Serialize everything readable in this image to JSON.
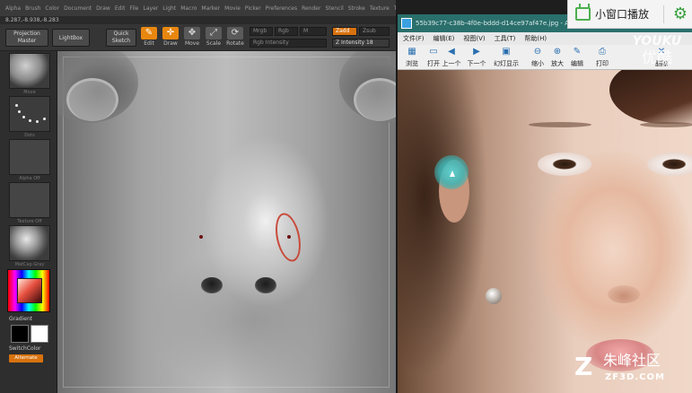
{
  "zbrush": {
    "menu": [
      "Alpha",
      "Brush",
      "Color",
      "Document",
      "Draw",
      "Edit",
      "File",
      "Layer",
      "Light",
      "Macro",
      "Marker",
      "Movie",
      "Picker",
      "Preferences",
      "Render",
      "Stencil",
      "Stroke",
      "Texture",
      "Tool",
      "Transform",
      "Zplugin",
      "Zscript"
    ],
    "coords": "8.287,-8.938,-8.283",
    "toolbar": {
      "projection_master": "Projection Master",
      "lightbox": "LightBox",
      "quick_sketch": "Quick Sketch",
      "edit": "Edit",
      "draw": "Draw",
      "move": "Move",
      "scale": "Scale",
      "rotate": "Rotate",
      "mrgb": "Mrgb",
      "rgb": "Rgb",
      "m": "M",
      "zadd": "Zadd",
      "zsub": "Zsub",
      "z_intensity": "Z Intensity 18",
      "rgb_intensity": "Rgb Intensity"
    },
    "shelf": {
      "brush_label": "Move",
      "stroke_label": "Dots",
      "alpha_label": "Alpha Off",
      "texture_label": "Texture Off",
      "material_label": "MatCap Gray",
      "gradient_label": "Gradient",
      "switchcolor_label": "SwitchColor",
      "alternate_label": "Alternate"
    }
  },
  "viewer": {
    "title": "55b39c77-c38b-4f0e-bddd-d14ce97af47e.jpg - ACDSee 9",
    "menu": [
      "文件(F)",
      "编辑(E)",
      "视图(V)",
      "工具(T)",
      "帮助(H)"
    ],
    "tools": [
      {
        "label": "浏览",
        "icon": "browse-icon",
        "glyph": "▦"
      },
      {
        "label": "打开",
        "icon": "open-folder-icon",
        "glyph": "▭"
      },
      {
        "label": "上一个",
        "icon": "previous-icon",
        "glyph": "◀"
      },
      {
        "label": "下一个",
        "icon": "next-icon",
        "glyph": "▶"
      },
      {
        "label": "幻灯显示",
        "icon": "slideshow-icon",
        "glyph": "▣"
      },
      {
        "label": "缩小",
        "icon": "zoom-out-icon",
        "glyph": "⊖"
      },
      {
        "label": "放大",
        "icon": "zoom-in-icon",
        "glyph": "⊕"
      },
      {
        "label": "编辑",
        "icon": "edit-icon",
        "glyph": "✎"
      },
      {
        "label": "打印",
        "icon": "print-icon",
        "glyph": "⎙"
      },
      {
        "label": "删除",
        "icon": "delete-icon",
        "glyph": "✕"
      }
    ]
  },
  "overlay": {
    "mini_window": "小窗口播放",
    "youku_en": "YOUKU",
    "youku_cn": "优酷",
    "zf_cn": "朱峰社区",
    "zf_en": "ZF3D.COM"
  }
}
